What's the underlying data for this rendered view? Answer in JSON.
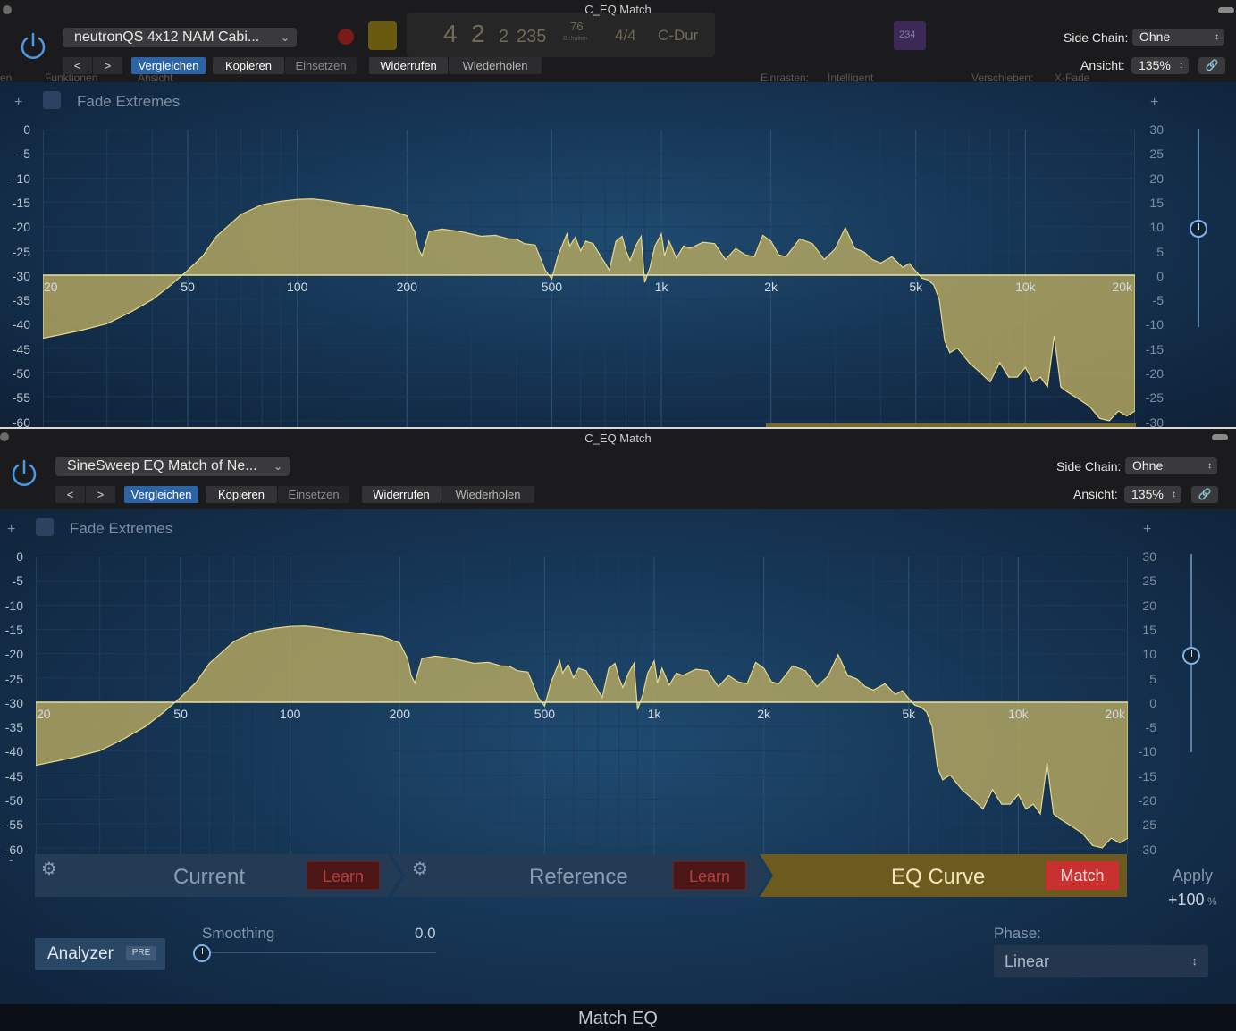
{
  "colors": {
    "accent": "#2d64a8",
    "curve_fill": "#bfae62",
    "curve_stroke": "#e8d98a",
    "learn_red": "#4d1616",
    "match_red": "#c8312f",
    "eq_bar": "#6d5a1f"
  },
  "icons": {
    "power": "power-icon",
    "back": "chevron-left-icon",
    "forward": "chevron-right-icon",
    "link": "link-icon",
    "gear": "gear-icon",
    "plus": "plus-icon",
    "knob": "knob-icon"
  },
  "top": {
    "title": "C_EQ Match",
    "preset": "neutronQS 4x12 NAM Cabi...",
    "nav_back": "<",
    "nav_forward": ">",
    "compare": "Vergleichen",
    "copy": "Kopieren",
    "paste": "Einsetzen",
    "undo": "Widerrufen",
    "redo": "Wiederholen",
    "sidechain_label": "Side Chain:",
    "sidechain_value": "Ohne",
    "view_label": "Ansicht:",
    "view_value": "135%",
    "fade_extremes": "Fade Extremes",
    "bg_transport": {
      "bar": "4",
      "beat": "2",
      "div": "2",
      "tick": "235",
      "tempo": "76",
      "tempo_label": "Behalten",
      "sig": "4/4",
      "key": "C-Dur",
      "midi": "234"
    },
    "bg_menu": {
      "functions": "Funktionen",
      "view": "Ansicht",
      "snap_label": "Einrasten:",
      "snap_value": "Intelligent",
      "move_label": "Verschieben:",
      "move_value": "X-Fade",
      "left": "en"
    }
  },
  "bottom": {
    "title": "C_EQ Match",
    "preset": "SineSweep EQ Match of Ne...",
    "nav_back": "<",
    "nav_forward": ">",
    "compare": "Vergleichen",
    "copy": "Kopieren",
    "paste": "Einsetzen",
    "undo": "Widerrufen",
    "redo": "Wiederholen",
    "sidechain_label": "Side Chain:",
    "sidechain_value": "Ohne",
    "view_label": "Ansicht:",
    "view_value": "135%",
    "fade_extremes": "Fade Extremes",
    "current": "Current",
    "current_learn": "Learn",
    "reference": "Reference",
    "reference_learn": "Learn",
    "eq_curve": "EQ Curve",
    "match": "Match",
    "apply_label": "Apply",
    "apply_value": "+100",
    "apply_unit": "%",
    "smoothing_label": "Smoothing",
    "smoothing_value": "0.0",
    "analyzer": "Analyzer",
    "analyzer_pre": "PRE",
    "phase_label": "Phase:",
    "phase_value": "Linear",
    "footer": "Match EQ",
    "minus_left": "-"
  },
  "axis": {
    "left_ticks": [
      "0",
      "-5",
      "-10",
      "-15",
      "-20",
      "-25",
      "-30",
      "-35",
      "-40",
      "-45",
      "-50",
      "-55",
      "-60"
    ],
    "right_ticks": [
      "30",
      "25",
      "20",
      "15",
      "10",
      "5",
      "0",
      "-5",
      "-10",
      "-15",
      "-20",
      "-25",
      "-30"
    ],
    "freq_labels": [
      "20",
      "50",
      "100",
      "200",
      "500",
      "1k",
      "2k",
      "5k",
      "10k",
      "20k"
    ],
    "plus": "+"
  },
  "curve": {
    "freq_hz": [
      20,
      25,
      30,
      35,
      40,
      45,
      50,
      55,
      60,
      70,
      80,
      90,
      100,
      110,
      120,
      140,
      160,
      180,
      190,
      200,
      210,
      215,
      220,
      230,
      250,
      280,
      300,
      320,
      350,
      380,
      400,
      420,
      450,
      480,
      500,
      520,
      550,
      560,
      580,
      600,
      620,
      650,
      680,
      700,
      720,
      750,
      780,
      800,
      820,
      850,
      880,
      900,
      930,
      960,
      1000,
      1020,
      1050,
      1100,
      1150,
      1200,
      1300,
      1400,
      1500,
      1600,
      1700,
      1800,
      1900,
      2000,
      2100,
      2200,
      2400,
      2600,
      2800,
      3000,
      3200,
      3400,
      3600,
      3800,
      4000,
      4300,
      4600,
      4800,
      5000,
      5200,
      5400,
      5600,
      5800,
      6000,
      6200,
      6500,
      7000,
      7500,
      8000,
      8500,
      9000,
      9500,
      10000,
      10500,
      11000,
      11500,
      12000,
      12500,
      13000,
      14000,
      15000,
      16000,
      17000,
      18000,
      19000,
      20000
    ],
    "gain_db": [
      -13,
      -11.5,
      -10,
      -7.5,
      -5,
      -2,
      1,
      4,
      8,
      12.5,
      14.5,
      15.2,
      15.6,
      15.7,
      15.4,
      14.6,
      14,
      13.5,
      12.8,
      12.2,
      9,
      5.5,
      4,
      9,
      9.5,
      9,
      8.5,
      8,
      8.2,
      7.5,
      7.4,
      6.5,
      6.2,
      1,
      -0.8,
      4,
      8.5,
      6,
      7.8,
      5,
      7,
      6.5,
      4,
      2.5,
      1,
      7,
      8,
      5,
      3,
      6,
      8,
      -1.5,
      1.5,
      6,
      8.5,
      4,
      7,
      3.5,
      6,
      5.5,
      6.8,
      6.5,
      3.2,
      5.5,
      4.2,
      3.8,
      8.2,
      7,
      4.2,
      3.8,
      7.5,
      6.5,
      3.2,
      5.4,
      9.8,
      5.5,
      4.8,
      3.2,
      2.5,
      3.8,
      1.6,
      2.4,
      0.8,
      -0.6,
      -1,
      -2,
      -5,
      -13.5,
      -16,
      -15,
      -18,
      -20,
      -22,
      -18,
      -21,
      -21,
      -19,
      -22,
      -21,
      -23,
      -12.5,
      -23,
      -24,
      -25.5,
      -27,
      -29.5,
      -30,
      -28,
      -29,
      -28
    ]
  }
}
